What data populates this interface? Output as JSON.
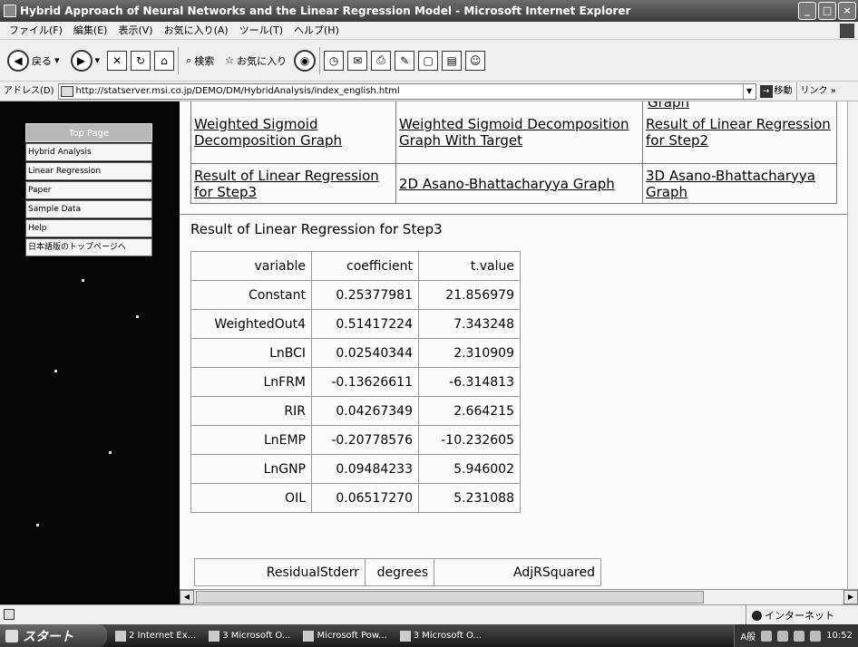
{
  "window": {
    "title": "Hybrid Approach of Neural Networks and the Linear Regression Model - Microsoft Internet Explorer",
    "buttons": [
      "_",
      "□",
      "×"
    ]
  },
  "menu": [
    "ファイル(F)",
    "編集(E)",
    "表示(V)",
    "お気に入り(A)",
    "ツール(T)",
    "ヘルプ(H)"
  ],
  "toolbar": {
    "back": "戻る",
    "search": "検索",
    "favorites": "お気に入り"
  },
  "address": {
    "label": "アドレス(D)",
    "url": "http://statserver.msi.co.jp/DEMO/DM/HybridAnalysis/index_english.html",
    "go": "移動",
    "links": "リンク »"
  },
  "sidebar": {
    "top": "Top Page",
    "items": [
      "Hybrid Analysis",
      "Linear Regression",
      "Paper",
      "Sample Data",
      "Help",
      "日本語版のトップページへ"
    ]
  },
  "nav": {
    "partial_top": "Graph",
    "row1": [
      "Weighted Sigmoid Decomposition Graph",
      "Weighted Sigmoid Decomposition Graph With Target",
      "Result of Linear Regression for Step2"
    ],
    "row2": [
      "Result of Linear Regression for Step3",
      "2D Asano-Bhattacharyya Graph",
      "3D Asano-Bhattacharyya Graph"
    ]
  },
  "section_title": "Result of Linear Regression for Step3",
  "coef_table": {
    "headers": [
      "variable",
      "coefficient",
      "t.value"
    ],
    "rows": [
      [
        "Constant",
        "0.25377981",
        "21.856979"
      ],
      [
        "WeightedOut4",
        "0.51417224",
        "7.343248"
      ],
      [
        "LnBCI",
        "0.02540344",
        "2.310909"
      ],
      [
        "LnFRM",
        "-0.13626611",
        "-6.314813"
      ],
      [
        "RIR",
        "0.04267349",
        "2.664215"
      ],
      [
        "LnEMP",
        "-0.20778576",
        "-10.232605"
      ],
      [
        "LnGNP",
        "0.09484233",
        "5.946002"
      ],
      [
        "OIL",
        "0.06517270",
        "5.231088"
      ]
    ]
  },
  "resid_table": {
    "headers": [
      "ResidualStderr",
      "degrees",
      "AdjRSquared"
    ]
  },
  "status": {
    "zone": "インターネット"
  },
  "taskbar": {
    "start": "スタート",
    "tasks": [
      "2 Internet Ex...",
      "3 Microsoft O...",
      "Microsoft Pow...",
      "3 Microsoft O..."
    ],
    "ime": "A般",
    "clock": "10:52"
  }
}
